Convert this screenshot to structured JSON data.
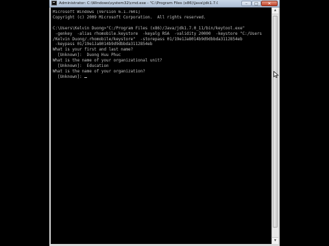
{
  "window": {
    "title": "Administrator: C:\\Windows\\system32\\cmd.exe - \"C:\\Program Files (x86)\\Java\\jdk1.7.0_11\\bin\\keyto...",
    "minimize_label": "–",
    "maximize_label": "□",
    "close_label": "✕"
  },
  "console": {
    "lines": [
      "Microsoft Windows [Version 6.1.7601]",
      "Copyright (c) 2009 Microsoft Corporation.  All rights reserved.",
      "",
      "C:\\Users\\Kelvin Duong>\"C:/Program Files (x86)/Java/jdk1.7.0_11/bin/keytool.exe\"",
      " -genkey  -alias rhomobile.keystore  -keyalg RSA  -validity 20000  -keystore \"C:/Users",
      "/Kelvin Duong/.rhomobile/keystore\"  -storepass 01/19e1Ja8014b9d9dbbda3112854eb",
      " -keypass 01/19e1Ja8014b9d9dbbda3112854eb",
      "What is your first and last name?",
      "  [Unknown]:  Duong Huu Phuc",
      "What is the name of your organizational unit?",
      "  [Unknown]:  Education",
      "What is the name of your organization?",
      "  [Unknown]: "
    ]
  },
  "scrollbar": {
    "up_arrow": "▲",
    "down_arrow": "▼"
  },
  "colors": {
    "console_background": "#000000",
    "console_text": "#c0c0c0",
    "titlebar": "#c9d7e8",
    "close_button": "#c2432a"
  }
}
